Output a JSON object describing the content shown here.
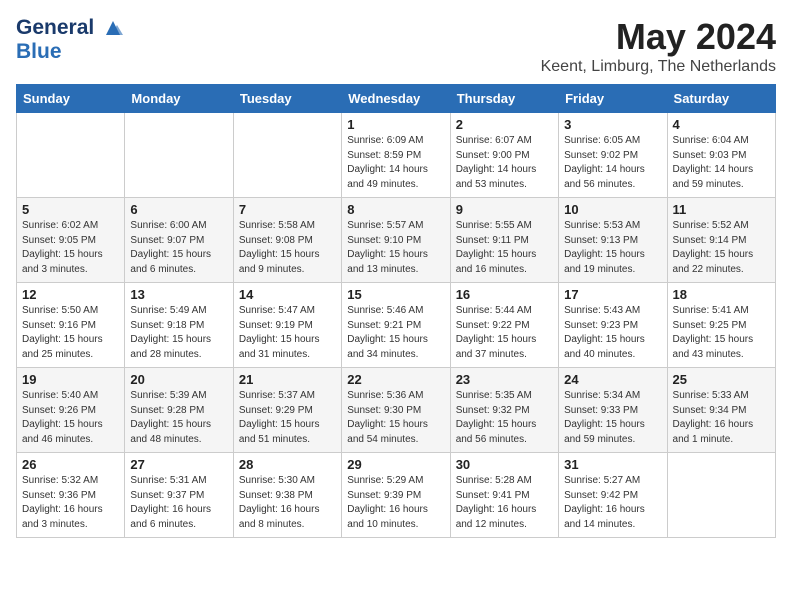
{
  "header": {
    "logo_line1": "General",
    "logo_line2": "Blue",
    "month_year": "May 2024",
    "location": "Keent, Limburg, The Netherlands"
  },
  "days_of_week": [
    "Sunday",
    "Monday",
    "Tuesday",
    "Wednesday",
    "Thursday",
    "Friday",
    "Saturday"
  ],
  "weeks": [
    [
      {
        "day": "",
        "content": ""
      },
      {
        "day": "",
        "content": ""
      },
      {
        "day": "",
        "content": ""
      },
      {
        "day": "1",
        "content": "Sunrise: 6:09 AM\nSunset: 8:59 PM\nDaylight: 14 hours\nand 49 minutes."
      },
      {
        "day": "2",
        "content": "Sunrise: 6:07 AM\nSunset: 9:00 PM\nDaylight: 14 hours\nand 53 minutes."
      },
      {
        "day": "3",
        "content": "Sunrise: 6:05 AM\nSunset: 9:02 PM\nDaylight: 14 hours\nand 56 minutes."
      },
      {
        "day": "4",
        "content": "Sunrise: 6:04 AM\nSunset: 9:03 PM\nDaylight: 14 hours\nand 59 minutes."
      }
    ],
    [
      {
        "day": "5",
        "content": "Sunrise: 6:02 AM\nSunset: 9:05 PM\nDaylight: 15 hours\nand 3 minutes."
      },
      {
        "day": "6",
        "content": "Sunrise: 6:00 AM\nSunset: 9:07 PM\nDaylight: 15 hours\nand 6 minutes."
      },
      {
        "day": "7",
        "content": "Sunrise: 5:58 AM\nSunset: 9:08 PM\nDaylight: 15 hours\nand 9 minutes."
      },
      {
        "day": "8",
        "content": "Sunrise: 5:57 AM\nSunset: 9:10 PM\nDaylight: 15 hours\nand 13 minutes."
      },
      {
        "day": "9",
        "content": "Sunrise: 5:55 AM\nSunset: 9:11 PM\nDaylight: 15 hours\nand 16 minutes."
      },
      {
        "day": "10",
        "content": "Sunrise: 5:53 AM\nSunset: 9:13 PM\nDaylight: 15 hours\nand 19 minutes."
      },
      {
        "day": "11",
        "content": "Sunrise: 5:52 AM\nSunset: 9:14 PM\nDaylight: 15 hours\nand 22 minutes."
      }
    ],
    [
      {
        "day": "12",
        "content": "Sunrise: 5:50 AM\nSunset: 9:16 PM\nDaylight: 15 hours\nand 25 minutes."
      },
      {
        "day": "13",
        "content": "Sunrise: 5:49 AM\nSunset: 9:18 PM\nDaylight: 15 hours\nand 28 minutes."
      },
      {
        "day": "14",
        "content": "Sunrise: 5:47 AM\nSunset: 9:19 PM\nDaylight: 15 hours\nand 31 minutes."
      },
      {
        "day": "15",
        "content": "Sunrise: 5:46 AM\nSunset: 9:21 PM\nDaylight: 15 hours\nand 34 minutes."
      },
      {
        "day": "16",
        "content": "Sunrise: 5:44 AM\nSunset: 9:22 PM\nDaylight: 15 hours\nand 37 minutes."
      },
      {
        "day": "17",
        "content": "Sunrise: 5:43 AM\nSunset: 9:23 PM\nDaylight: 15 hours\nand 40 minutes."
      },
      {
        "day": "18",
        "content": "Sunrise: 5:41 AM\nSunset: 9:25 PM\nDaylight: 15 hours\nand 43 minutes."
      }
    ],
    [
      {
        "day": "19",
        "content": "Sunrise: 5:40 AM\nSunset: 9:26 PM\nDaylight: 15 hours\nand 46 minutes."
      },
      {
        "day": "20",
        "content": "Sunrise: 5:39 AM\nSunset: 9:28 PM\nDaylight: 15 hours\nand 48 minutes."
      },
      {
        "day": "21",
        "content": "Sunrise: 5:37 AM\nSunset: 9:29 PM\nDaylight: 15 hours\nand 51 minutes."
      },
      {
        "day": "22",
        "content": "Sunrise: 5:36 AM\nSunset: 9:30 PM\nDaylight: 15 hours\nand 54 minutes."
      },
      {
        "day": "23",
        "content": "Sunrise: 5:35 AM\nSunset: 9:32 PM\nDaylight: 15 hours\nand 56 minutes."
      },
      {
        "day": "24",
        "content": "Sunrise: 5:34 AM\nSunset: 9:33 PM\nDaylight: 15 hours\nand 59 minutes."
      },
      {
        "day": "25",
        "content": "Sunrise: 5:33 AM\nSunset: 9:34 PM\nDaylight: 16 hours\nand 1 minute."
      }
    ],
    [
      {
        "day": "26",
        "content": "Sunrise: 5:32 AM\nSunset: 9:36 PM\nDaylight: 16 hours\nand 3 minutes."
      },
      {
        "day": "27",
        "content": "Sunrise: 5:31 AM\nSunset: 9:37 PM\nDaylight: 16 hours\nand 6 minutes."
      },
      {
        "day": "28",
        "content": "Sunrise: 5:30 AM\nSunset: 9:38 PM\nDaylight: 16 hours\nand 8 minutes."
      },
      {
        "day": "29",
        "content": "Sunrise: 5:29 AM\nSunset: 9:39 PM\nDaylight: 16 hours\nand 10 minutes."
      },
      {
        "day": "30",
        "content": "Sunrise: 5:28 AM\nSunset: 9:41 PM\nDaylight: 16 hours\nand 12 minutes."
      },
      {
        "day": "31",
        "content": "Sunrise: 5:27 AM\nSunset: 9:42 PM\nDaylight: 16 hours\nand 14 minutes."
      },
      {
        "day": "",
        "content": ""
      }
    ]
  ]
}
